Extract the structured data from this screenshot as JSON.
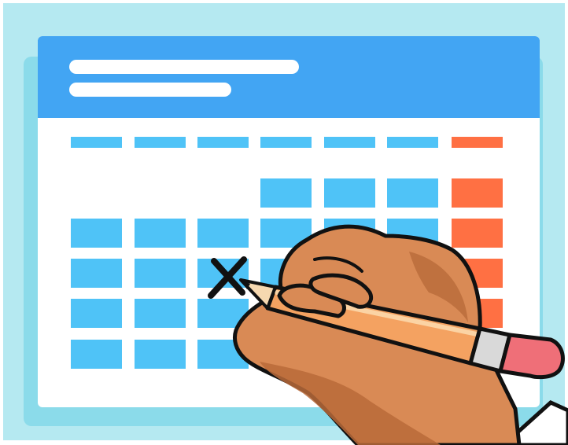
{
  "illustration": {
    "subject": "calendar-with-hand-marking-date",
    "icons": [
      "calendar-icon",
      "pencil-icon",
      "hand-icon",
      "x-mark-icon"
    ]
  },
  "colors": {
    "background_frame": "#b5e9f1",
    "background_shadow": "#8bdbea",
    "calendar_header": "#42a5f3",
    "header_placeholder_text": "#ffffff",
    "calendar_body": "#ffffff",
    "day_cell": "#4fc3f7",
    "weekend_cell": "#ff7043",
    "skin": "#d98a55",
    "skin_shadow": "#b86a3a",
    "pencil_body": "#f4a261",
    "pencil_eraser": "#ef6f78",
    "pencil_ferrule": "#d9d9d9",
    "outline": "#111111"
  },
  "calendar": {
    "columns": 7,
    "header_lines": 2,
    "weekday_header_count": 7,
    "weeks": [
      {
        "week": 1,
        "filled_columns": [
          4,
          5,
          6,
          7
        ]
      },
      {
        "week": 2,
        "filled_columns": [
          1,
          2,
          3,
          4,
          5,
          6,
          7
        ]
      },
      {
        "week": 3,
        "filled_columns": [
          1,
          2,
          3,
          4,
          5,
          6,
          7
        ]
      },
      {
        "week": 4,
        "filled_columns": [
          1,
          2,
          3,
          4,
          5,
          6,
          7
        ]
      },
      {
        "week": 5,
        "filled_columns": [
          1,
          2,
          3,
          4,
          5,
          6,
          7
        ]
      }
    ],
    "marked_cell": {
      "week": 3,
      "column": 3,
      "mark": "x"
    }
  }
}
